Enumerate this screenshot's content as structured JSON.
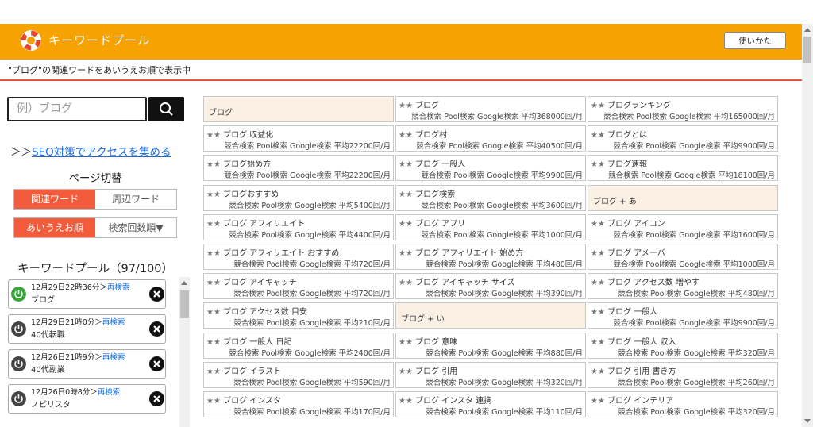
{
  "header": {
    "title": "キーワードプール",
    "usage_button": "使いかた"
  },
  "subtitle": "\"ブログ\"の関連ワードをあいうえお順で表示中",
  "search": {
    "placeholder": "例）ブログ"
  },
  "seo": {
    "prefix": "＞＞",
    "link": "SEO対策でアクセスを集める"
  },
  "page_switch": {
    "title": "ページ切替",
    "mode": [
      "関連ワード",
      "周辺ワード"
    ],
    "sort": [
      "あいうえお順",
      "検索回数順▼"
    ]
  },
  "pool": {
    "title": "キーワードプール（97/100）",
    "research_label": "再検索",
    "items": [
      {
        "time": "12月29日22時36分＞",
        "keyword": "ブログ",
        "active": true
      },
      {
        "time": "12月29日21時0分＞",
        "keyword": "40代転職",
        "active": false
      },
      {
        "time": "12月26日21時9分＞",
        "keyword": "40代副業",
        "active": false
      },
      {
        "time": "12月26日0時8分＞",
        "keyword": "ノピリスタ",
        "active": false
      }
    ]
  },
  "stats_labels": {
    "competition": "競合検索",
    "pool": "Pool検索",
    "google": "Google検索"
  },
  "grid": [
    {
      "type": "head",
      "text": "ブログ"
    },
    {
      "stars": "★★",
      "kw": "ブログ",
      "avg": "平均368000回/月"
    },
    {
      "stars": "★★",
      "kw": "ブログランキング",
      "avg": "平均165000回/月"
    },
    {
      "stars": "★★",
      "kw": "ブログ 収益化",
      "avg": "平均22200回/月"
    },
    {
      "stars": "★★",
      "kw": "ブログ村",
      "avg": "平均40500回/月"
    },
    {
      "stars": "★★",
      "kw": "ブログとは",
      "avg": "平均9900回/月"
    },
    {
      "stars": "★★",
      "kw": "ブログ始め方",
      "avg": "平均22200回/月"
    },
    {
      "stars": "★★",
      "kw": "ブログ 一般人",
      "avg": "平均9900回/月"
    },
    {
      "stars": "★★",
      "kw": "ブログ速報",
      "avg": "平均18100回/月"
    },
    {
      "stars": "★★",
      "kw": "ブログおすすめ",
      "avg": "平均5400回/月"
    },
    {
      "stars": "★★",
      "kw": "ブログ検索",
      "avg": "平均3600回/月"
    },
    {
      "type": "head",
      "text": "ブログ + あ"
    },
    {
      "stars": "★★",
      "kw": "ブログ アフィリエイト",
      "avg": "平均4400回/月"
    },
    {
      "stars": "★★",
      "kw": "ブログ アプリ",
      "avg": "平均1000回/月"
    },
    {
      "stars": "★★",
      "kw": "ブログ アイコン",
      "avg": "平均1600回/月"
    },
    {
      "stars": "★★",
      "kw": "ブログ アフィリエイト おすすめ",
      "avg": "平均720回/月"
    },
    {
      "stars": "★★",
      "kw": "ブログ アフィリエイト 始め方",
      "avg": "平均480回/月"
    },
    {
      "stars": "★★",
      "kw": "ブログ アメーバ",
      "avg": "平均1000回/月"
    },
    {
      "stars": "★★",
      "kw": "ブログ アイキャッチ",
      "avg": "平均720回/月"
    },
    {
      "stars": "★★",
      "kw": "ブログ アイキャッチ サイズ",
      "avg": "平均390回/月"
    },
    {
      "stars": "★★",
      "kw": "ブログ アクセス数 増やす",
      "avg": "平均480回/月"
    },
    {
      "stars": "★★",
      "kw": "ブログ アクセス数 目安",
      "avg": "平均210回/月"
    },
    {
      "type": "head",
      "text": "ブログ + い"
    },
    {
      "stars": "★★",
      "kw": "ブログ 一般人",
      "avg": "平均9900回/月"
    },
    {
      "stars": "★★",
      "kw": "ブログ 一般人 日記",
      "avg": "平均2400回/月"
    },
    {
      "stars": "★★",
      "kw": "ブログ 意味",
      "avg": "平均880回/月"
    },
    {
      "stars": "★★",
      "kw": "ブログ 一般人 収入",
      "avg": "平均320回/月"
    },
    {
      "stars": "★★",
      "kw": "ブログ イラスト",
      "avg": "平均590回/月"
    },
    {
      "stars": "★★",
      "kw": "ブログ 引用",
      "avg": "平均320回/月"
    },
    {
      "stars": "★★",
      "kw": "ブログ 引用 書き方",
      "avg": "平均260回/月"
    },
    {
      "stars": "★★",
      "kw": "ブログ インスタ",
      "avg": "平均170回/月"
    },
    {
      "stars": "★★",
      "kw": "ブログ インスタ 連携",
      "avg": "平均110回/月"
    },
    {
      "stars": "★★",
      "kw": "ブログ インテリア",
      "avg": "平均320回/月"
    }
  ]
}
